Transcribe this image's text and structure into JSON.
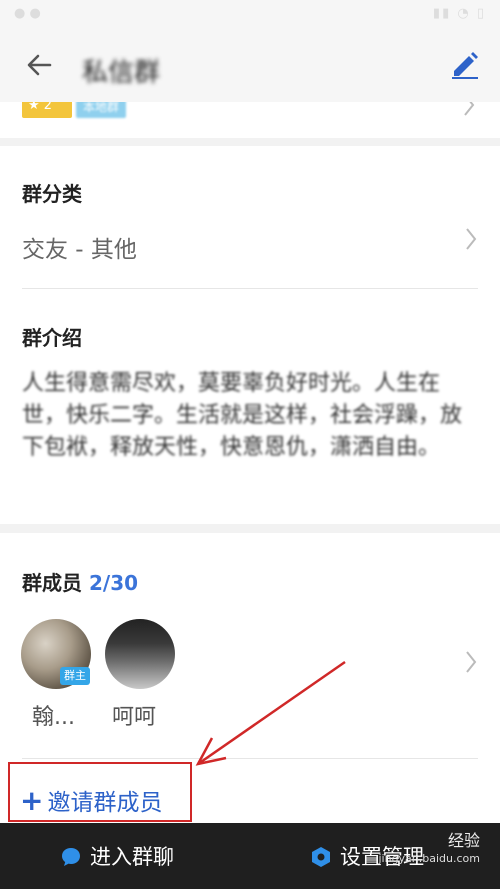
{
  "app": {
    "title": "私信群",
    "back_icon": "arrow-left-icon",
    "edit_icon": "pencil-icon"
  },
  "tags": {
    "level": "2",
    "local": "本地群"
  },
  "category": {
    "label": "群分类",
    "value": "交友 - 其他"
  },
  "intro": {
    "label": "群介绍",
    "text": "人生得意需尽欢，莫要辜负好时光。人生在世，快乐二字。生活就是这样，社会浮躁，放下包袱，释放天性，快意恩仇，潇洒自由。"
  },
  "members": {
    "label": "群成员",
    "count": "2/30",
    "owner_badge": "群主",
    "list": [
      {
        "name": "翰..."
      },
      {
        "name": "呵呵"
      }
    ],
    "invite_label": "邀请群成员"
  },
  "bottombar": {
    "chat_label": "进入群聊",
    "settings_label": "设置管理"
  },
  "watermark": {
    "line1": "经验",
    "url": "jingyan.baidu.com"
  },
  "colors": {
    "accent": "#2d62c9",
    "annotation": "#d02828",
    "bottom_bg": "#1f1f1f"
  }
}
